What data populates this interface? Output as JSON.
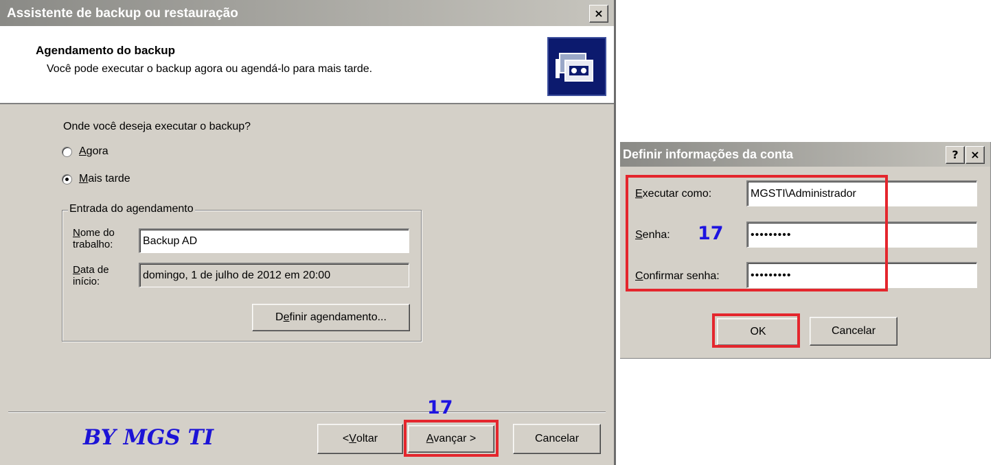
{
  "wizard": {
    "title": "Assistente de backup ou restauração",
    "close_glyph": "×",
    "header_title": "Agendamento do backup",
    "header_subtitle": "Você pode executar o backup agora ou agendá-lo para mais tarde.",
    "header_icon": "backup-tape-icon",
    "question": "Onde você deseja executar o backup?",
    "options": [
      {
        "mnemonic": "A",
        "rest": "gora",
        "selected": false
      },
      {
        "mnemonic": "M",
        "rest": "ais tarde",
        "selected": true
      }
    ],
    "group": {
      "legend": "Entrada do agendamento",
      "job_name_label": {
        "mnemonic": "N",
        "line1_rest": "ome do",
        "line2": "trabalho:"
      },
      "job_name_value": "Backup AD",
      "start_date_label": {
        "mnemonic": "D",
        "line1_rest": "ata de",
        "line2": "início:"
      },
      "start_date_value": "domingo, 1 de julho de 2012 em 20:00",
      "schedule_button": {
        "before": "D",
        "mnemonic": "e",
        "after": "finir agendamento..."
      }
    },
    "brand": "BY MGS TI",
    "annotation": "17",
    "buttons": {
      "back": {
        "before": "< ",
        "mnemonic": "V",
        "after": "oltar"
      },
      "next": {
        "mnemonic": "A",
        "after": "vançar >"
      },
      "cancel": "Cancelar"
    }
  },
  "account_dialog": {
    "title": "Definir informações da conta",
    "help_glyph": "?",
    "close_glyph": "×",
    "run_as": {
      "mnemonic": "E",
      "rest": "xecutar como:",
      "value": "MGSTI\\Administrador"
    },
    "password": {
      "mnemonic": "S",
      "rest": "enha:",
      "value": "•••••••••"
    },
    "confirm": {
      "mnemonic": "C",
      "rest": "onfirmar senha:",
      "value": "•••••••••"
    },
    "annotation": "17",
    "ok": "OK",
    "cancel": "Cancelar"
  },
  "colors": {
    "highlight_red": "#e4262d",
    "annotation_blue": "#1e14e0",
    "dialog_gray": "#d4d0c8"
  }
}
